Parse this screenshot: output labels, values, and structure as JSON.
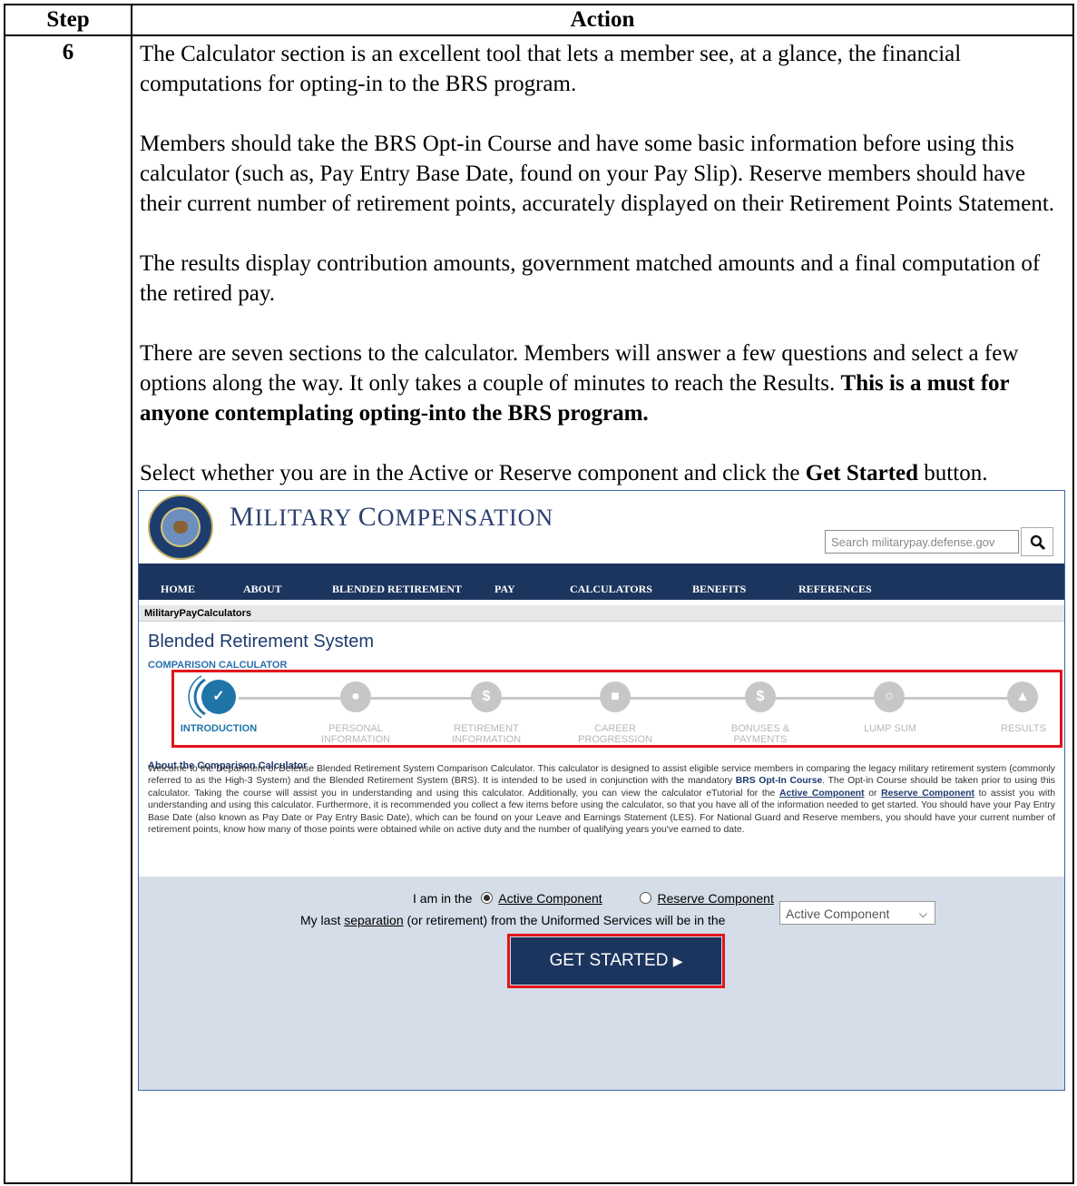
{
  "table": {
    "header_step": "Step",
    "header_action": "Action",
    "step_number": "6"
  },
  "action": {
    "p1": "The Calculator section is an excellent tool that lets a member see, at a glance, the financial computations for opting-in to the BRS program.",
    "p2": "Members should take the BRS Opt-in Course and have some basic information before using this calculator (such as, Pay Entry Base Date, found on your Pay Slip).  Reserve members should have their current number of retirement points, accurately displayed on their Retirement Points Statement.",
    "p3": "The results display contribution amounts, government matched amounts and a final computation of the retired pay.",
    "p4_plain": "There are seven sections to the calculator.  Members will answer a few questions and select a few options along the way.  It only takes a couple of minutes to reach the Results. ",
    "p4_bold": "This is a must for anyone contemplating opting-into the BRS program.",
    "p5_a": "Select whether you are in the Active or Reserve component and click the ",
    "p5_bold": "Get Started",
    "p5_b": " button."
  },
  "screenshot": {
    "site_title_first": "M",
    "site_title_rest": "ILITARY ",
    "site_title_second": "C",
    "site_title_rest2": "OMPENSATION",
    "search_placeholder": "Search militarypay.defense.gov",
    "nav": [
      "HOME",
      "ABOUT",
      "BLENDED RETIREMENT",
      "PAY",
      "CALCULATORS",
      "BENEFITS",
      "REFERENCES"
    ],
    "breadcrumb": "MilitaryPayCalculators",
    "page_title": "Blended Retirement System",
    "page_subtitle": "COMPARISON CALCULATOR",
    "steps": [
      {
        "label": "INTRODUCTION",
        "label2": "",
        "active": true
      },
      {
        "label": "PERSONAL",
        "label2": "INFORMATION",
        "active": false
      },
      {
        "label": "RETIREMENT",
        "label2": "INFORMATION",
        "active": false
      },
      {
        "label": "CAREER",
        "label2": "PROGRESSION",
        "active": false
      },
      {
        "label": "BONUSES &",
        "label2": "PAYMENTS",
        "active": false
      },
      {
        "label": "LUMP SUM",
        "label2": "",
        "active": false
      },
      {
        "label": "RESULTS",
        "label2": "",
        "active": false
      }
    ],
    "about_title": "About the Comparison Calculator",
    "about_1": "Welcome to the Department of Defense Blended Retirement System Comparison Calculator. This calculator is designed to assist eligible service members in comparing the legacy military retirement system (commonly referred to as the High-3 System) and the Blended Retirement System (BRS). It is intended to be used in conjunction with the mandatory ",
    "about_link1": "BRS Opt-In Course",
    "about_2": ". The Opt-in Course should be taken prior to using this calculator. Taking the course will assist you in understanding and using this calculator. Additionally, you can view the calculator eTutorial for the ",
    "about_link2": "Active Component",
    "about_3": " or ",
    "about_link3": "Reserve Component",
    "about_4": " to assist you with understanding and using this calculator. Furthermore, it is recommended you collect a few items before using the calculator, so that you have all of the information needed to get started. You should have your Pay Entry Base Date (also known as Pay Date or Pay Entry Basic Date), which can be found on your Leave and Earnings Statement (LES). For National Guard and Reserve members, you should have your current number of retirement points, know how many of those points were obtained while on active duty and the number of qualifying years you've earned to date.",
    "component_prefix": "I am in the",
    "component_active": "Active Component",
    "component_reserve": "Reserve Component",
    "separation_a": "My last ",
    "separation_link": "separation",
    "separation_b": " (or retirement) from the Uniformed Services will be in the",
    "separation_selected": "Active Component",
    "get_started": "GET STARTED"
  }
}
